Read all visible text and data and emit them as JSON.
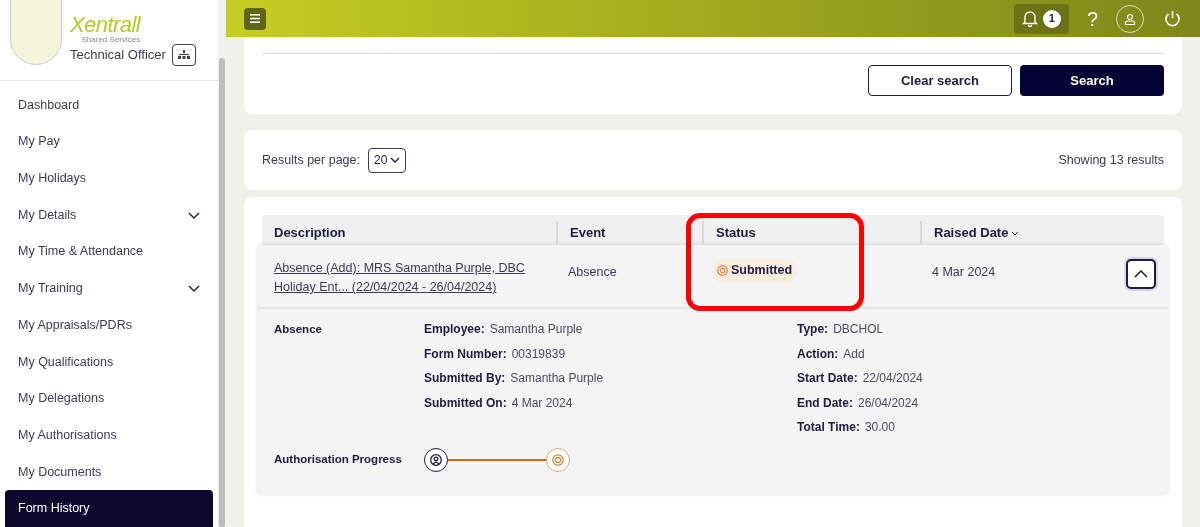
{
  "sidebar": {
    "logo": {
      "name": "Xentrall",
      "tagline": "Shared Services"
    },
    "role": "Technical Officer",
    "items": [
      {
        "label": "Dashboard",
        "selected": false,
        "expandable": false
      },
      {
        "label": "My Pay",
        "selected": false,
        "expandable": false
      },
      {
        "label": "My Holidays",
        "selected": false,
        "expandable": false
      },
      {
        "label": "My Details",
        "selected": false,
        "expandable": true
      },
      {
        "label": "My Time & Attendance",
        "selected": false,
        "expandable": false
      },
      {
        "label": "My Training",
        "selected": false,
        "expandable": true
      },
      {
        "label": "My Appraisals/PDRs",
        "selected": false,
        "expandable": false
      },
      {
        "label": "My Qualifications",
        "selected": false,
        "expandable": false
      },
      {
        "label": "My Delegations",
        "selected": false,
        "expandable": false
      },
      {
        "label": "My Authorisations",
        "selected": false,
        "expandable": false
      },
      {
        "label": "My Documents",
        "selected": false,
        "expandable": false
      },
      {
        "label": "Form History",
        "selected": true,
        "expandable": false
      }
    ]
  },
  "top_bar": {
    "notification_count": "1",
    "help": "?"
  },
  "search_panel": {
    "buttons": [
      "Clear search",
      "Search"
    ]
  },
  "results_bar": {
    "per_page_label": "Results per page:",
    "per_page": "20",
    "summary": "Showing 13 results"
  },
  "table": {
    "columns": [
      {
        "label": "Description",
        "sorted": false
      },
      {
        "label": "Event",
        "sorted": false
      },
      {
        "label": "Status",
        "sorted": false
      },
      {
        "label": "Raised Date",
        "sorted": true
      }
    ],
    "rows": [
      {
        "description": "Absence (Add): MRS Samantha Purple, DBC Holiday Ent... (22/04/2024 - 26/04/2024)",
        "event": "Absence",
        "status": "Submitted",
        "raised_date": "4 Mar 2024",
        "expanded": true,
        "details": {
          "heading": "Absence",
          "left": [
            {
              "label": "Employee:",
              "value": "Samantha Purple"
            },
            {
              "label": "Form Number:",
              "value": "00319839"
            },
            {
              "label": "Submitted By:",
              "value": "Samantha Purple"
            },
            {
              "label": "Submitted On:",
              "value": "4 Mar 2024"
            }
          ],
          "right": [
            {
              "label": "Type:",
              "value": "DBCHOL"
            },
            {
              "label": "Action:",
              "value": "Add"
            },
            {
              "label": "Start Date:",
              "value": "22/04/2024"
            },
            {
              "label": "End Date:",
              "value": "26/04/2024"
            },
            {
              "label": "Total Time:",
              "value": "30.00"
            }
          ],
          "progress_label": "Authorisation Progress",
          "progress_steps": [
            {
              "kind": "done"
            },
            {
              "kind": "pending"
            }
          ]
        }
      }
    ]
  }
}
